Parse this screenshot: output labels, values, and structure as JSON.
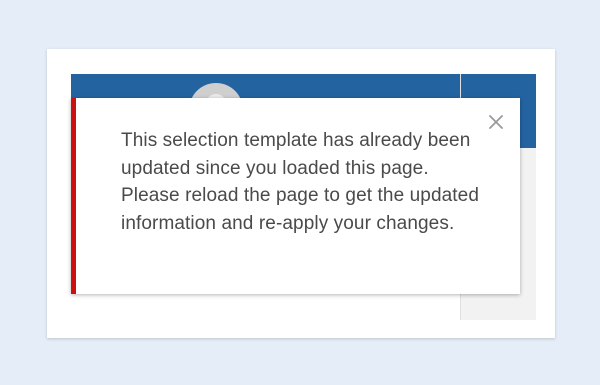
{
  "alert": {
    "message": "This selection template has already been updated since you loaded this page. Please reload the page to get the updated information and re-apply your changes.",
    "close_icon": "close-icon"
  },
  "colors": {
    "page_background": "#e5eef8",
    "header": "#2363a0",
    "alert_accent": "#cc1111",
    "text": "#4a4a4a",
    "close_icon": "#9a9a9a"
  }
}
